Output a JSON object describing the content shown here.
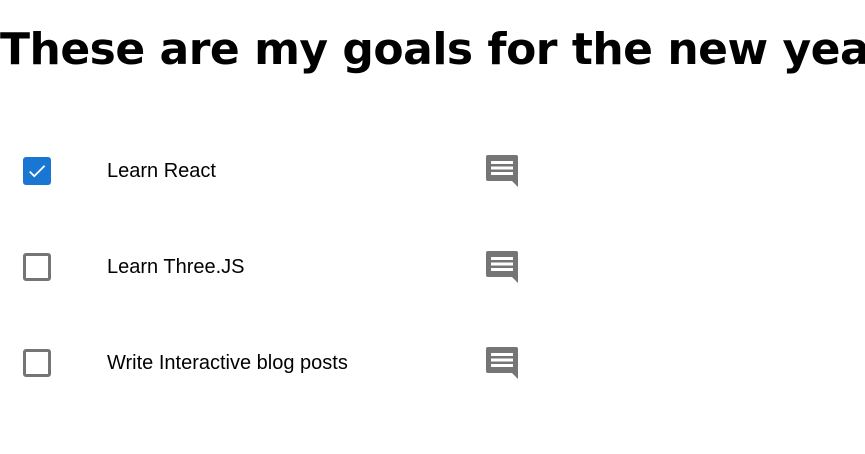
{
  "page": {
    "title": "These are my goals for the new year"
  },
  "todos": [
    {
      "label": "Learn React",
      "checked": true,
      "comment_icon": "comment-icon"
    },
    {
      "label": "Learn Three.JS",
      "checked": false,
      "comment_icon": "comment-icon"
    },
    {
      "label": "Write Interactive blog posts",
      "checked": false,
      "comment_icon": "comment-icon"
    }
  ],
  "colors": {
    "checkbox_checked": "#1976d2",
    "checkbox_border": "#757575",
    "comment_icon": "#757575",
    "text": "#000000"
  }
}
